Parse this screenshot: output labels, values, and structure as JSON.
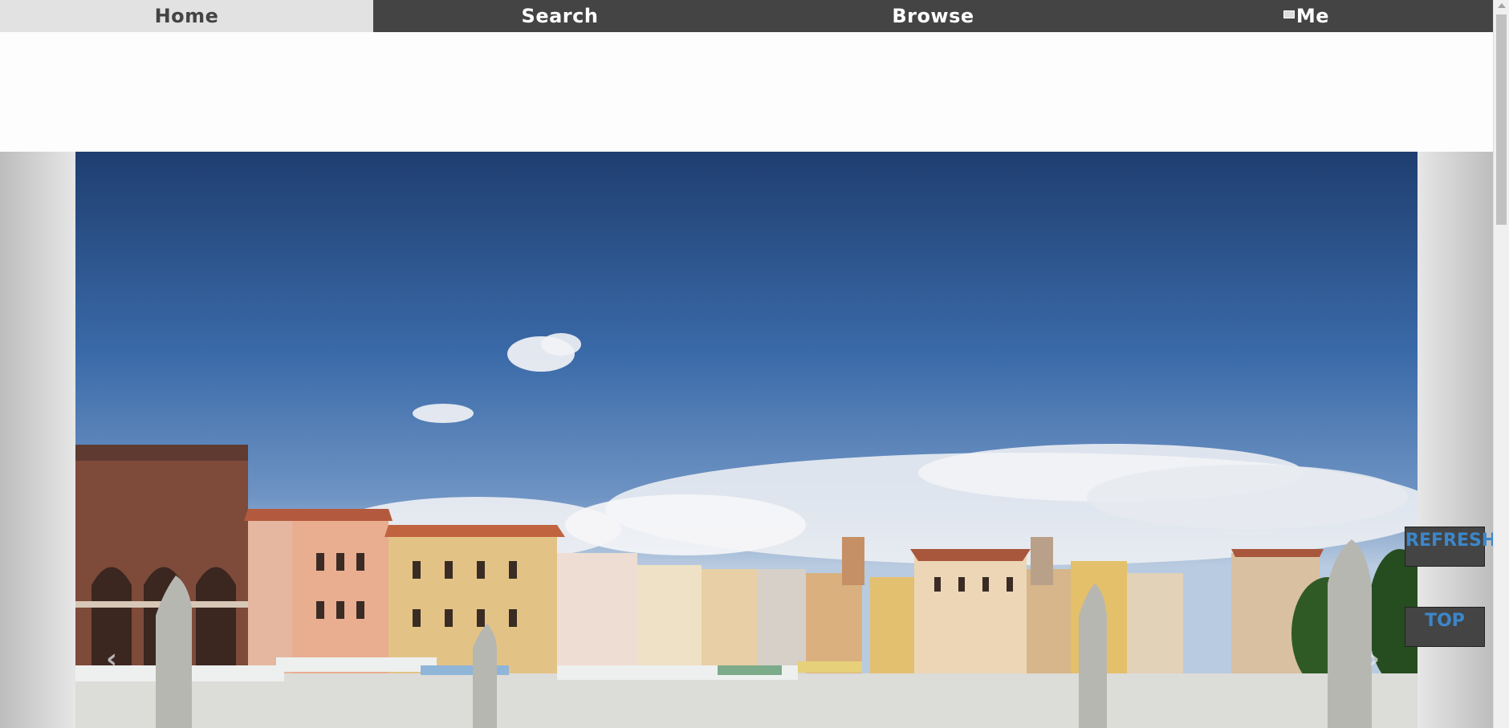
{
  "nav": {
    "items": [
      {
        "label": "Home",
        "active": true
      },
      {
        "label": "Search",
        "active": false
      },
      {
        "label": "Browse",
        "active": false
      },
      {
        "label": "Me",
        "active": false,
        "icon": "mail-icon"
      }
    ]
  },
  "buttons": {
    "refresh": "REFRESH",
    "top": "TOP"
  },
  "carousel": {
    "prev_icon": "chevron-left-icon",
    "next_icon": "chevron-right-icon",
    "prev_glyph": "‹",
    "next_glyph": "›"
  },
  "colors": {
    "nav_bg": "#444444",
    "nav_active_bg": "#e2e2e2",
    "button_text": "#3c86c9"
  }
}
